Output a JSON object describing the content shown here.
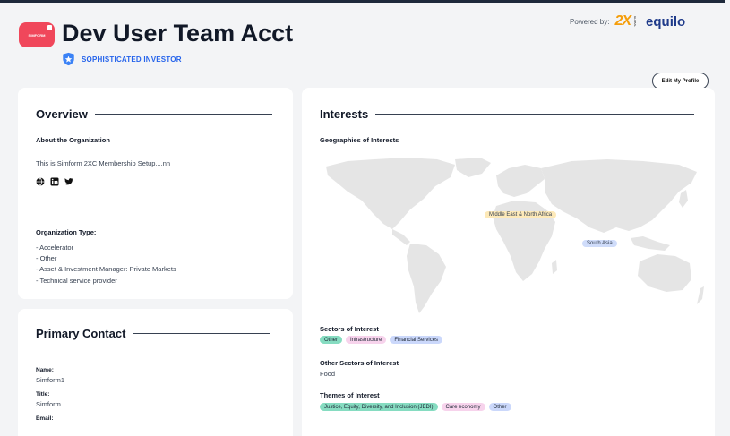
{
  "header": {
    "logo_text": "SIMFORM",
    "org_name": "Dev User Team Acct",
    "badge": "SOPHISTICATED INVESTOR",
    "powered_by": "Powered by:",
    "brand_2x": "2X",
    "brand_2x_sub": "GLOBAL",
    "brand_equilo": "equilo",
    "edit_profile": "Edit My Profile"
  },
  "overview": {
    "title": "Overview",
    "about_label": "About the Organization",
    "about_text": "This is Simform 2XC Membership Setup....nn",
    "icons": [
      "globe-icon",
      "linkedin-icon",
      "twitter-icon"
    ],
    "org_type_label": "Organization Type:",
    "org_types": [
      "- Accelerator",
      "- Other",
      "- Asset & Investment Manager: Private Markets",
      "- Technical service provider"
    ]
  },
  "contact": {
    "title": "Primary Contact",
    "name_label": "Name:",
    "name_value": "Simform1",
    "title_label": "Title:",
    "title_value": "Simform",
    "email_label": "Email:"
  },
  "interests": {
    "title": "Interests",
    "geographies_label": "Geographies of Interests",
    "regions": [
      "Middle East & North Africa",
      "South Asia"
    ],
    "sectors_label": "Sectors of Interest",
    "sectors": [
      "Other",
      "Infrastructure",
      "Financial Services"
    ],
    "other_sectors_label": "Other Sectors of Interest",
    "other_sectors_value": "Food",
    "themes_label": "Themes of Interest",
    "themes": [
      "Justice, Equity, Diversity, and Inclusion (JEDI)",
      "Care economy",
      "Other"
    ]
  },
  "colors": {
    "brand_red": "#f0475b",
    "badge_blue": "#2563eb",
    "tag_green": "#86dcc1",
    "tag_pink": "#f7d3ec",
    "tag_blue": "#cbd8fb",
    "region_mena": "#fde9b8",
    "region_south_asia": "#cfdcfa"
  }
}
